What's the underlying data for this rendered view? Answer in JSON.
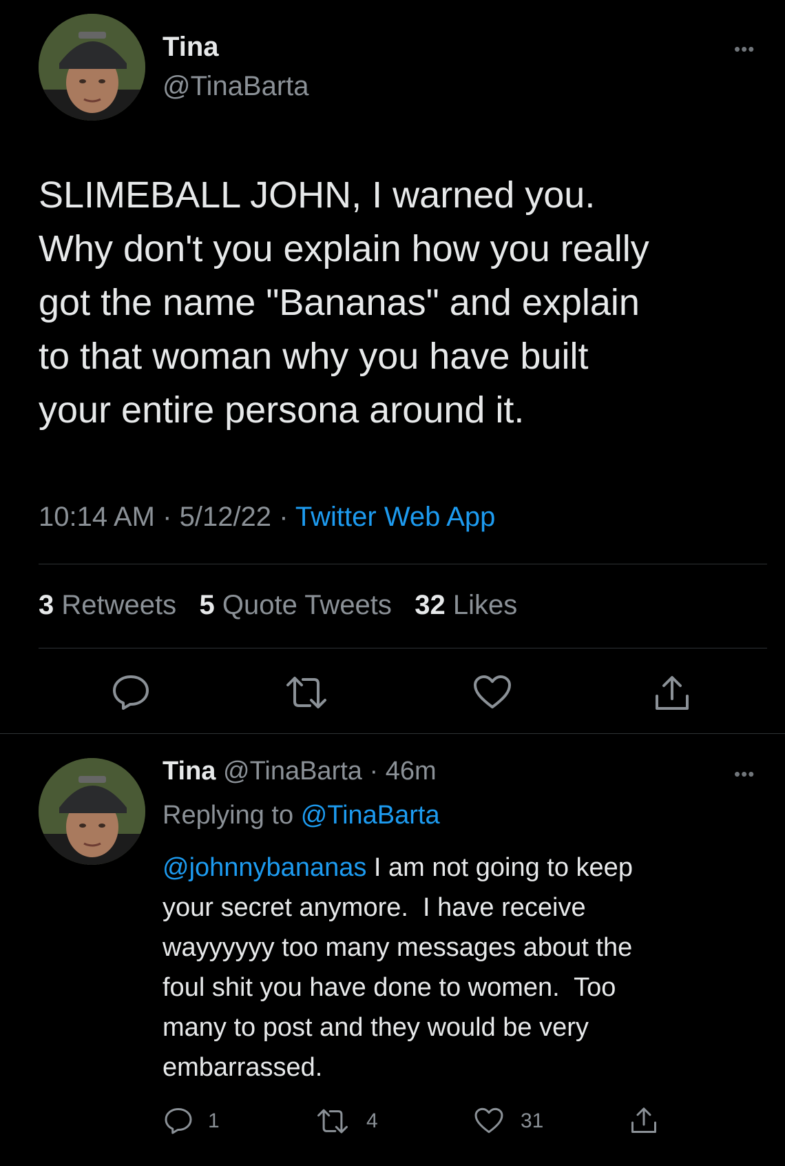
{
  "main_tweet": {
    "author_name": "Tina",
    "author_handle": "@TinaBarta",
    "text": "SLIMEBALL JOHN, I warned you.\nWhy don't you explain how you really\ngot the name \"Bananas\" and explain\nto that woman why you have built\nyour entire persona around it.",
    "time": "10:14 AM",
    "date": "5/12/22",
    "separator": "·",
    "source": "Twitter Web App",
    "stats": {
      "retweets_count": "3",
      "retweets_label": "Retweets",
      "quotes_count": "5",
      "quotes_label": "Quote Tweets",
      "likes_count": "32",
      "likes_label": "Likes"
    },
    "more_label": "•••"
  },
  "reply_tweet": {
    "author_name": "Tina",
    "author_handle": "@TinaBarta",
    "age": "46m",
    "separator": "·",
    "replying_label": "Replying to",
    "replying_handle": "@TinaBarta",
    "mention": "@johnnybananas",
    "text": " I am not going to keep\nyour secret anymore.  I have receive\nwayyyyyy too many messages about the\nfoul shit you have done to women.  Too\nmany to post and they would be very\nembarrassed.",
    "reply_count": "1",
    "retweet_count": "4",
    "like_count": "31",
    "more_label": "•••"
  },
  "icons": {
    "reply": "reply-icon",
    "retweet": "retweet-icon",
    "like": "heart-icon",
    "share": "share-icon",
    "more": "more-icon"
  },
  "colors": {
    "background": "#000000",
    "text": "#e7e9ea",
    "secondary": "#8b9197",
    "link": "#1d9bf0",
    "divider": "#2f3336"
  }
}
